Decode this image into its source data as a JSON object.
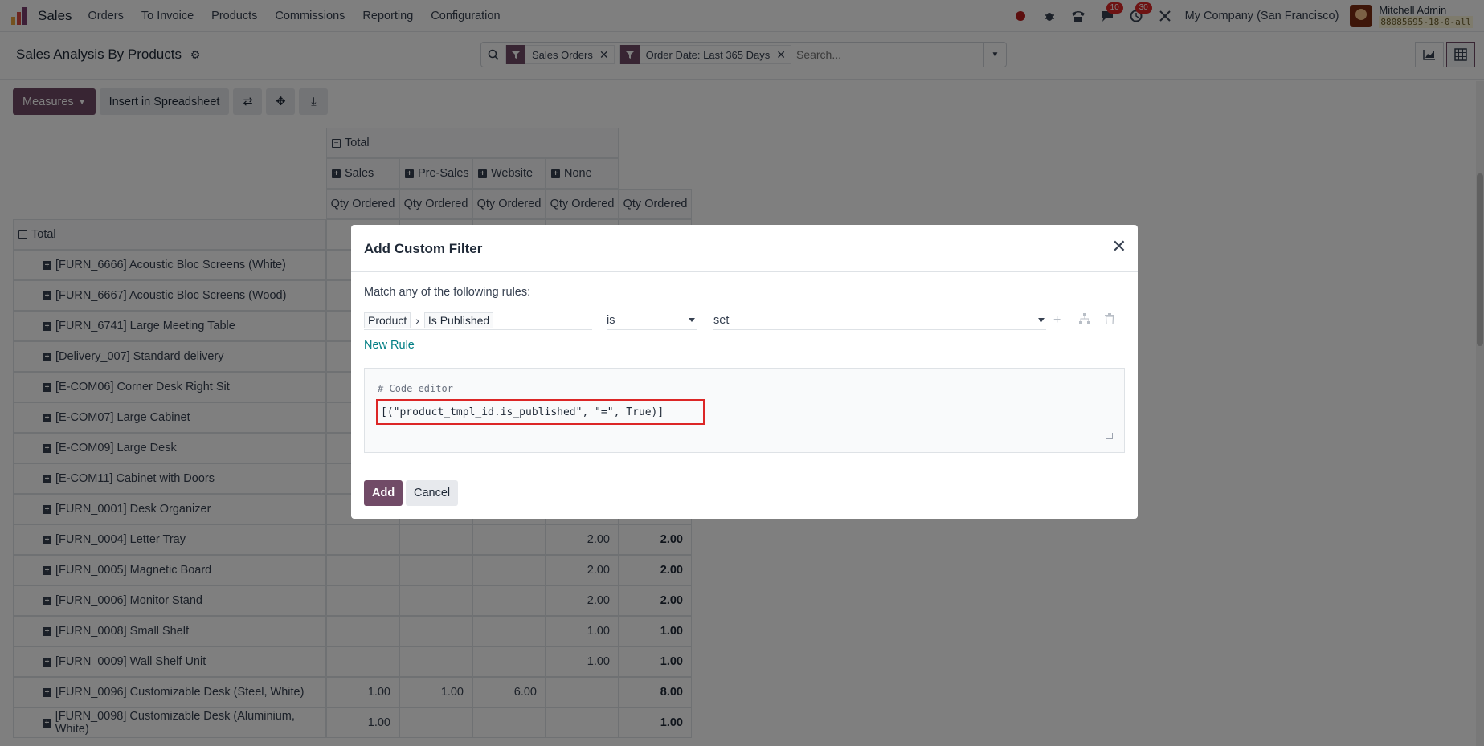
{
  "navbar": {
    "app_name": "Sales",
    "menu": [
      "Orders",
      "To Invoice",
      "Products",
      "Commissions",
      "Reporting",
      "Configuration"
    ],
    "messages_badge": "10",
    "activities_badge": "30",
    "company": "My Company (San Francisco)",
    "user_name": "Mitchell Admin",
    "user_db": "88085695-18-0-all"
  },
  "control_panel": {
    "title": "Sales Analysis By Products",
    "facets": [
      "Sales Orders",
      "Order Date: Last 365 Days"
    ],
    "search_placeholder": "Search..."
  },
  "toolbar": {
    "measures": "Measures",
    "insert": "Insert in Spreadsheet"
  },
  "pivot": {
    "total_header": "Total",
    "col_groups": [
      "Sales",
      "Pre-Sales",
      "Website",
      "None"
    ],
    "measure": "Qty Ordered",
    "row_total": "Total",
    "rows": [
      {
        "label": "[FURN_6666] Acoustic Bloc Screens (White)",
        "values": [
          "",
          "",
          "",
          "",
          ""
        ]
      },
      {
        "label": "[FURN_6667] Acoustic Bloc Screens (Wood)",
        "values": [
          "",
          "",
          "",
          "",
          ""
        ]
      },
      {
        "label": "[FURN_6741] Large Meeting Table",
        "values": [
          "",
          "",
          "",
          "",
          ""
        ]
      },
      {
        "label": "[Delivery_007] Standard delivery",
        "values": [
          "",
          "",
          "",
          "",
          ""
        ]
      },
      {
        "label": "[E-COM06] Corner Desk Right Sit",
        "values": [
          "",
          "",
          "",
          "",
          ""
        ]
      },
      {
        "label": "[E-COM07] Large Cabinet",
        "values": [
          "",
          "",
          "",
          "",
          ""
        ]
      },
      {
        "label": "[E-COM09] Large Desk",
        "values": [
          "",
          "",
          "",
          "",
          ""
        ]
      },
      {
        "label": "[E-COM11] Cabinet with Doors",
        "values": [
          "",
          "",
          "",
          "",
          ""
        ]
      },
      {
        "label": "[FURN_0001] Desk Organizer",
        "values": [
          "",
          "",
          "",
          "",
          ""
        ]
      },
      {
        "label": "[FURN_0004] Letter Tray",
        "values": [
          "",
          "",
          "",
          "2.00",
          "2.00"
        ]
      },
      {
        "label": "[FURN_0005] Magnetic Board",
        "values": [
          "",
          "",
          "",
          "2.00",
          "2.00"
        ]
      },
      {
        "label": "[FURN_0006] Monitor Stand",
        "values": [
          "",
          "",
          "",
          "2.00",
          "2.00"
        ]
      },
      {
        "label": "[FURN_0008] Small Shelf",
        "values": [
          "",
          "",
          "",
          "1.00",
          "1.00"
        ]
      },
      {
        "label": "[FURN_0009] Wall Shelf Unit",
        "values": [
          "",
          "",
          "",
          "1.00",
          "1.00"
        ]
      },
      {
        "label": "[FURN_0096] Customizable Desk (Steel, White)",
        "values": [
          "1.00",
          "1.00",
          "6.00",
          "",
          "8.00"
        ]
      },
      {
        "label": "[FURN_0098] Customizable Desk (Aluminium, White)",
        "values": [
          "1.00",
          "",
          "",
          "",
          "1.00"
        ]
      }
    ]
  },
  "modal": {
    "title": "Add Custom Filter",
    "match_text": "Match any of the following rules:",
    "path": [
      "Product",
      "Is Published"
    ],
    "operator": "is",
    "value": "set",
    "new_rule": "New Rule",
    "code_comment": "# Code editor",
    "code": "[(\"product_tmpl_id.is_published\", \"=\", True)]",
    "add": "Add",
    "cancel": "Cancel"
  },
  "colors": {
    "primary": "#714b67",
    "link": "#017e84",
    "highlight": "#dc2626"
  }
}
